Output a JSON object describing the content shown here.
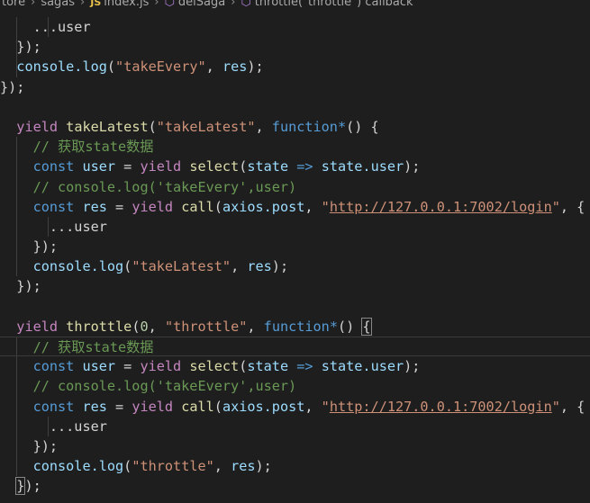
{
  "breadcrumb": {
    "items": [
      "tore",
      "sagas",
      "index.js",
      "delSaga",
      "throttle(\"throttle\") callback"
    ]
  },
  "colors": {
    "background": "#1e1e1e",
    "keyword": "#569cd6",
    "control": "#c586c0",
    "function": "#dcdcaa",
    "string": "#ce9178",
    "variable": "#9cdcfe",
    "comment": "#6a9955",
    "number": "#b5cea8"
  },
  "code": {
    "spread_user": "...user",
    "close_call": "});",
    "close_block": "});",
    "log_fn": "console.log",
    "block1": {
      "log_label": "\"takeEvery\"",
      "log_var": "res"
    },
    "block2": {
      "yield": "yield",
      "effect": "takeLatest",
      "name": "\"takeLatest\"",
      "fn_kw": "function",
      "comment": "// 获取state数据",
      "const_kw": "const",
      "user_var": "user",
      "select_fn": "select",
      "state_var": "state",
      "arrow": "=>",
      "state_user": "state.user",
      "comment2": "// console.log('takeEvery',user)",
      "res_var": "res",
      "call_fn": "call",
      "axios_post": "axios.post",
      "url": "http://127.0.0.1:7002/login",
      "log_label": "\"takeLatest\""
    },
    "block3": {
      "effect": "throttle",
      "delay": "0",
      "name": "\"throttle\"",
      "log_label": "\"throttle\""
    }
  }
}
